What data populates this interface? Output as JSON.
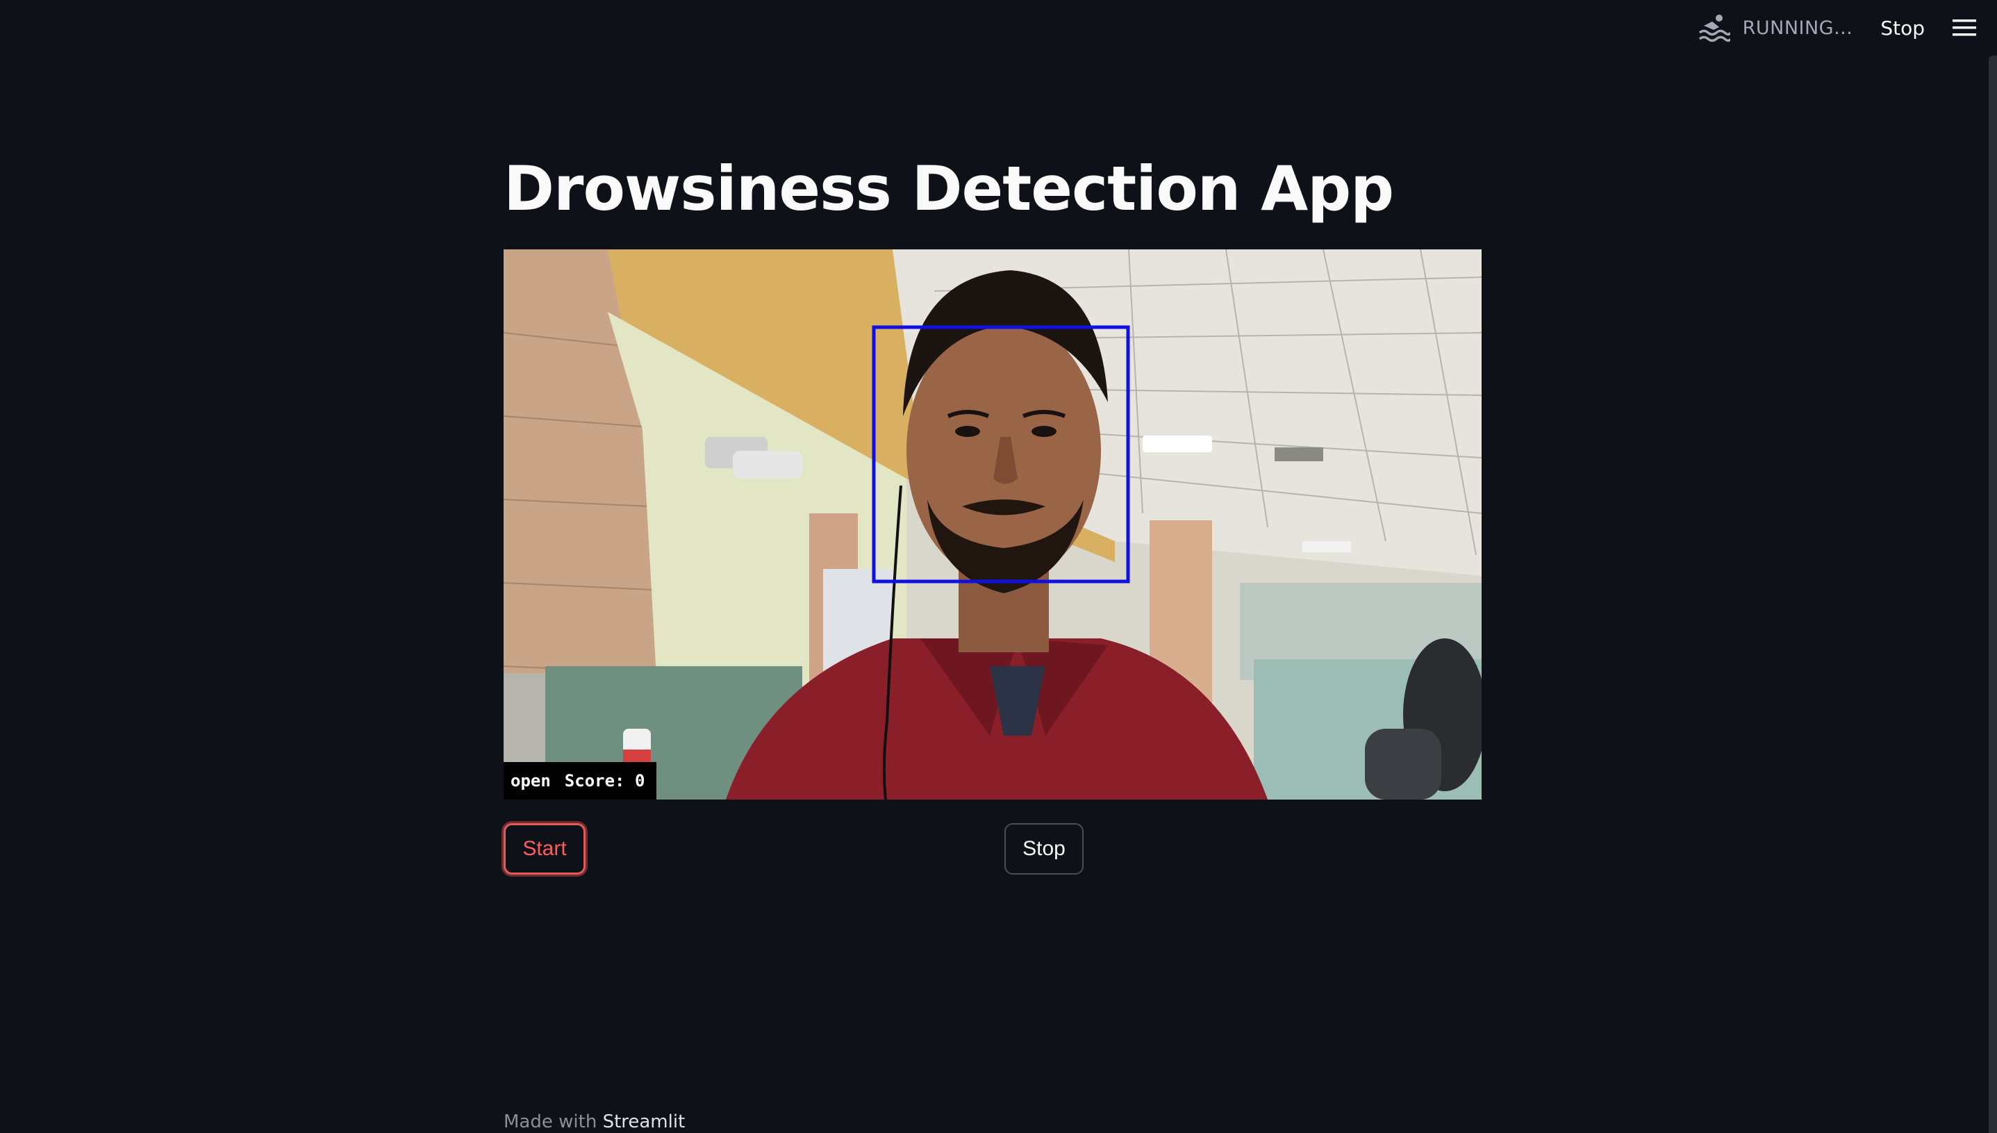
{
  "status": {
    "running_label": "RUNNING...",
    "stop_label": "Stop"
  },
  "page": {
    "title": "Drowsiness Detection App"
  },
  "video": {
    "overlay_state": "open",
    "overlay_score": "Score: 0",
    "face_box_color": "#1010e0"
  },
  "controls": {
    "start_label": "Start",
    "stop_label": "Stop"
  },
  "footer": {
    "prefix": "Made with",
    "brand": "Streamlit"
  },
  "colors": {
    "background": "#0e1117",
    "accent": "#ff4b4b"
  },
  "icons": {
    "status": "swimmer-icon",
    "menu": "hamburger-menu-icon"
  }
}
